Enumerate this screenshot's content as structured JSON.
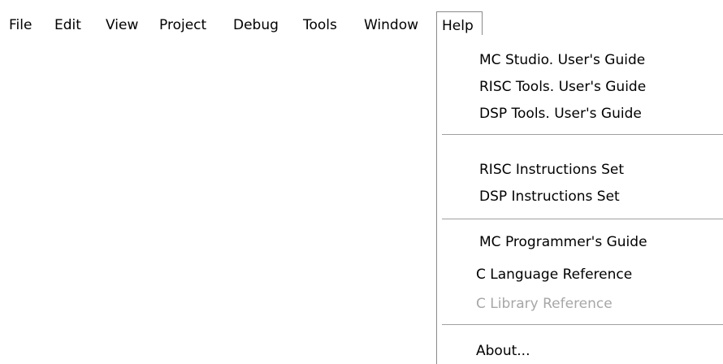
{
  "menubar": {
    "file": "File",
    "edit": "Edit",
    "view": "View",
    "project": "Project",
    "debug": "Debug",
    "tools": "Tools",
    "window": "Window",
    "help": "Help"
  },
  "help_menu": {
    "mc_studio_guide": "MC Studio.  User's Guide",
    "risc_tools_guide": "RISC Tools.  User's Guide",
    "dsp_tools_guide": "DSP  Tools.  User's Guide",
    "risc_instructions": "RISC Instructions Set",
    "dsp_instructions": "DSP  Instructions  Set",
    "mc_programmers_guide": "MC Programmer's Guide",
    "c_language_reference": "C Language Reference",
    "c_library_reference": "C Library Reference",
    "about": "About..."
  }
}
